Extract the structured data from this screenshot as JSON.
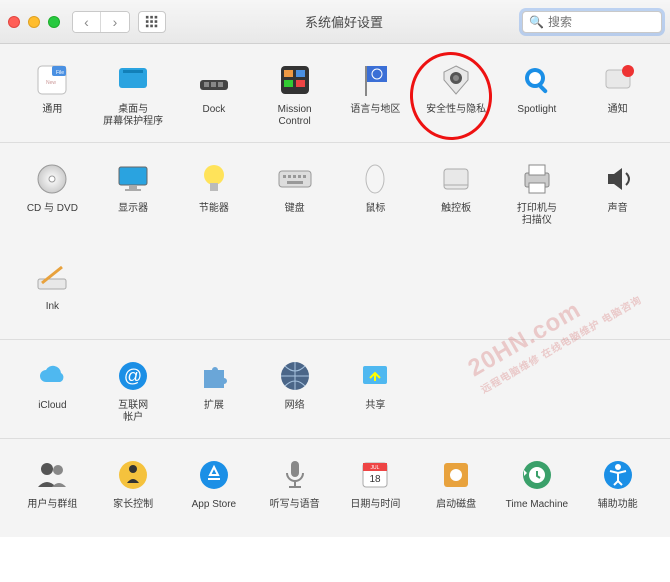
{
  "window": {
    "title": "系统偏好设置"
  },
  "search": {
    "placeholder": "搜索"
  },
  "rows": {
    "r1": {
      "general": "通用",
      "desktop": "桌面与\n屏幕保护程序",
      "dock": "Dock",
      "mission": "Mission\nControl",
      "language": "语言与地区",
      "security": "安全性与隐私",
      "spotlight": "Spotlight",
      "notifications": "通知"
    },
    "r2": {
      "cddvd": "CD 与 DVD",
      "displays": "显示器",
      "energy": "节能器",
      "keyboard": "键盘",
      "mouse": "鼠标",
      "trackpad": "触控板",
      "printers": "打印机与\n扫描仪",
      "sound": "声音"
    },
    "r3": {
      "ink": "Ink"
    },
    "r4": {
      "icloud": "iCloud",
      "internet": "互联网\n帐户",
      "extensions": "扩展",
      "network": "网络",
      "sharing": "共享"
    },
    "r5": {
      "users": "用户与群组",
      "parental": "家长控制",
      "appstore": "App Store",
      "dictation": "听写与语音",
      "datetime": "日期与时间",
      "startup": "启动磁盘",
      "timemachine": "Time Machine",
      "accessibility": "辅助功能"
    }
  },
  "watermark": {
    "main": "20HN.com",
    "sub": "远程电脑维修 在线电脑维护 电脑咨询"
  }
}
